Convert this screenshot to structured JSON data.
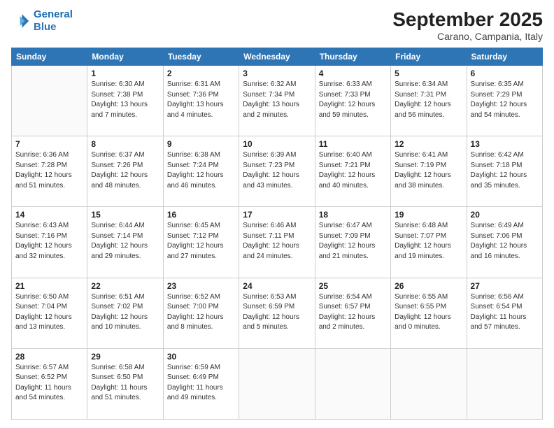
{
  "logo": {
    "line1": "General",
    "line2": "Blue"
  },
  "title": "September 2025",
  "location": "Carano, Campania, Italy",
  "weekdays": [
    "Sunday",
    "Monday",
    "Tuesday",
    "Wednesday",
    "Thursday",
    "Friday",
    "Saturday"
  ],
  "weeks": [
    [
      {
        "day": "",
        "info": ""
      },
      {
        "day": "1",
        "info": "Sunrise: 6:30 AM\nSunset: 7:38 PM\nDaylight: 13 hours\nand 7 minutes."
      },
      {
        "day": "2",
        "info": "Sunrise: 6:31 AM\nSunset: 7:36 PM\nDaylight: 13 hours\nand 4 minutes."
      },
      {
        "day": "3",
        "info": "Sunrise: 6:32 AM\nSunset: 7:34 PM\nDaylight: 13 hours\nand 2 minutes."
      },
      {
        "day": "4",
        "info": "Sunrise: 6:33 AM\nSunset: 7:33 PM\nDaylight: 12 hours\nand 59 minutes."
      },
      {
        "day": "5",
        "info": "Sunrise: 6:34 AM\nSunset: 7:31 PM\nDaylight: 12 hours\nand 56 minutes."
      },
      {
        "day": "6",
        "info": "Sunrise: 6:35 AM\nSunset: 7:29 PM\nDaylight: 12 hours\nand 54 minutes."
      }
    ],
    [
      {
        "day": "7",
        "info": "Sunrise: 6:36 AM\nSunset: 7:28 PM\nDaylight: 12 hours\nand 51 minutes."
      },
      {
        "day": "8",
        "info": "Sunrise: 6:37 AM\nSunset: 7:26 PM\nDaylight: 12 hours\nand 48 minutes."
      },
      {
        "day": "9",
        "info": "Sunrise: 6:38 AM\nSunset: 7:24 PM\nDaylight: 12 hours\nand 46 minutes."
      },
      {
        "day": "10",
        "info": "Sunrise: 6:39 AM\nSunset: 7:23 PM\nDaylight: 12 hours\nand 43 minutes."
      },
      {
        "day": "11",
        "info": "Sunrise: 6:40 AM\nSunset: 7:21 PM\nDaylight: 12 hours\nand 40 minutes."
      },
      {
        "day": "12",
        "info": "Sunrise: 6:41 AM\nSunset: 7:19 PM\nDaylight: 12 hours\nand 38 minutes."
      },
      {
        "day": "13",
        "info": "Sunrise: 6:42 AM\nSunset: 7:18 PM\nDaylight: 12 hours\nand 35 minutes."
      }
    ],
    [
      {
        "day": "14",
        "info": "Sunrise: 6:43 AM\nSunset: 7:16 PM\nDaylight: 12 hours\nand 32 minutes."
      },
      {
        "day": "15",
        "info": "Sunrise: 6:44 AM\nSunset: 7:14 PM\nDaylight: 12 hours\nand 29 minutes."
      },
      {
        "day": "16",
        "info": "Sunrise: 6:45 AM\nSunset: 7:12 PM\nDaylight: 12 hours\nand 27 minutes."
      },
      {
        "day": "17",
        "info": "Sunrise: 6:46 AM\nSunset: 7:11 PM\nDaylight: 12 hours\nand 24 minutes."
      },
      {
        "day": "18",
        "info": "Sunrise: 6:47 AM\nSunset: 7:09 PM\nDaylight: 12 hours\nand 21 minutes."
      },
      {
        "day": "19",
        "info": "Sunrise: 6:48 AM\nSunset: 7:07 PM\nDaylight: 12 hours\nand 19 minutes."
      },
      {
        "day": "20",
        "info": "Sunrise: 6:49 AM\nSunset: 7:06 PM\nDaylight: 12 hours\nand 16 minutes."
      }
    ],
    [
      {
        "day": "21",
        "info": "Sunrise: 6:50 AM\nSunset: 7:04 PM\nDaylight: 12 hours\nand 13 minutes."
      },
      {
        "day": "22",
        "info": "Sunrise: 6:51 AM\nSunset: 7:02 PM\nDaylight: 12 hours\nand 10 minutes."
      },
      {
        "day": "23",
        "info": "Sunrise: 6:52 AM\nSunset: 7:00 PM\nDaylight: 12 hours\nand 8 minutes."
      },
      {
        "day": "24",
        "info": "Sunrise: 6:53 AM\nSunset: 6:59 PM\nDaylight: 12 hours\nand 5 minutes."
      },
      {
        "day": "25",
        "info": "Sunrise: 6:54 AM\nSunset: 6:57 PM\nDaylight: 12 hours\nand 2 minutes."
      },
      {
        "day": "26",
        "info": "Sunrise: 6:55 AM\nSunset: 6:55 PM\nDaylight: 12 hours\nand 0 minutes."
      },
      {
        "day": "27",
        "info": "Sunrise: 6:56 AM\nSunset: 6:54 PM\nDaylight: 11 hours\nand 57 minutes."
      }
    ],
    [
      {
        "day": "28",
        "info": "Sunrise: 6:57 AM\nSunset: 6:52 PM\nDaylight: 11 hours\nand 54 minutes."
      },
      {
        "day": "29",
        "info": "Sunrise: 6:58 AM\nSunset: 6:50 PM\nDaylight: 11 hours\nand 51 minutes."
      },
      {
        "day": "30",
        "info": "Sunrise: 6:59 AM\nSunset: 6:49 PM\nDaylight: 11 hours\nand 49 minutes."
      },
      {
        "day": "",
        "info": ""
      },
      {
        "day": "",
        "info": ""
      },
      {
        "day": "",
        "info": ""
      },
      {
        "day": "",
        "info": ""
      }
    ]
  ]
}
